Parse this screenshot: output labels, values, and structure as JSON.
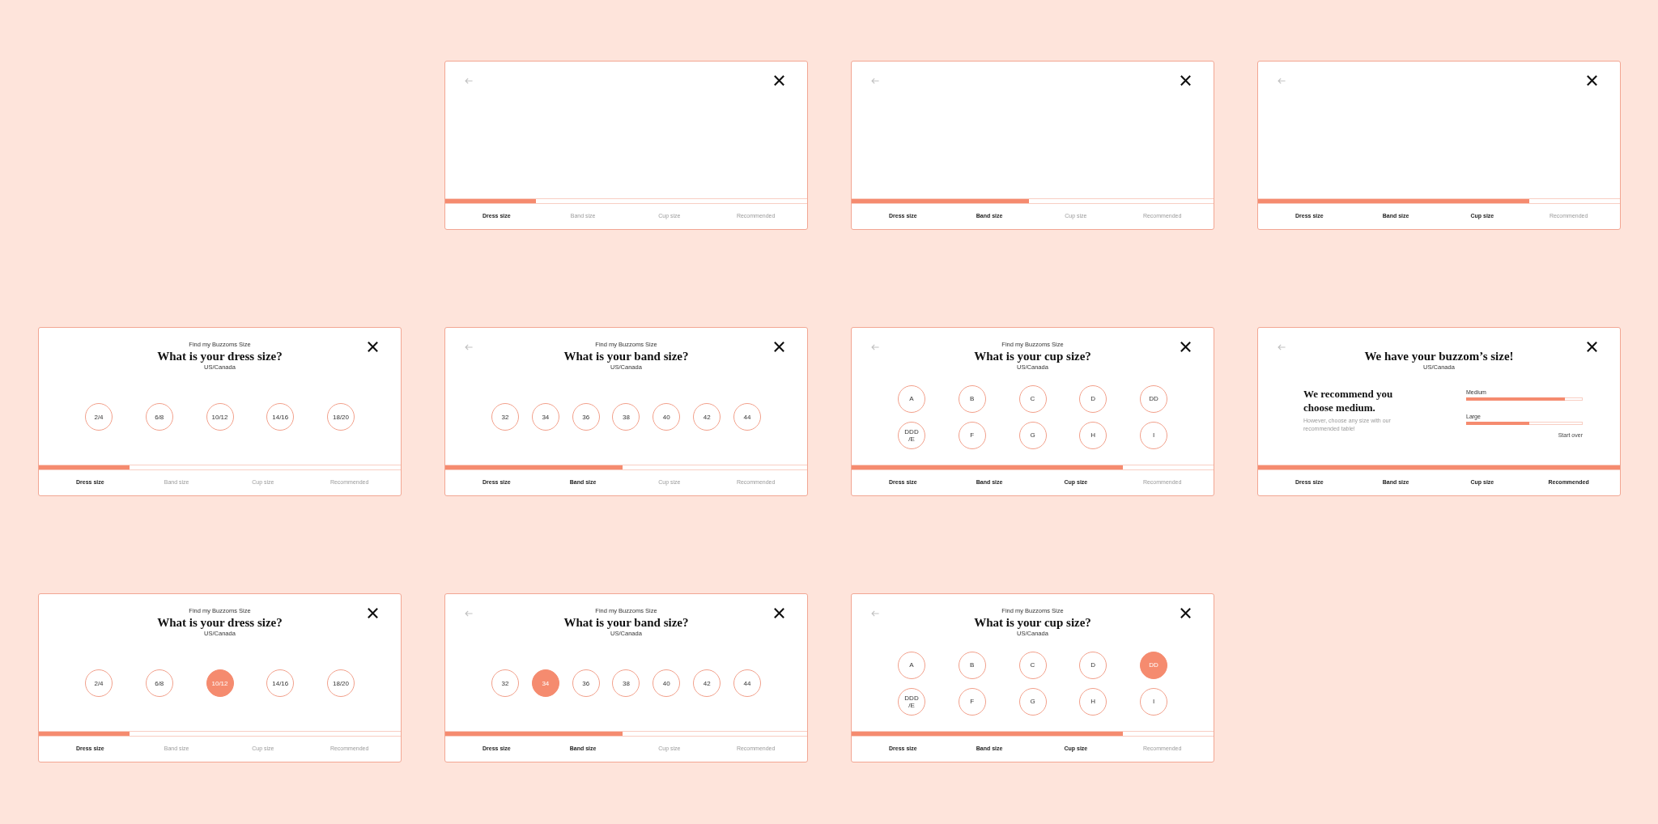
{
  "rows": [
    {
      "cards": [
        {
          "kind": "blank",
          "back_button": true,
          "progress": {
            "level": 0.25
          },
          "steps": [
            {
              "label": "Dress size",
              "active": true
            },
            {
              "label": "Band size",
              "active": false
            },
            {
              "label": "Cup size",
              "active": false
            },
            {
              "label": "Recommended",
              "active": false
            }
          ]
        },
        {
          "kind": "blank",
          "back_button": true,
          "progress": {
            "level": 0.49
          },
          "steps": [
            {
              "label": "Dress size",
              "active": true
            },
            {
              "label": "Band size",
              "active": true
            },
            {
              "label": "Cup size",
              "active": false
            },
            {
              "label": "Recommended",
              "active": false
            }
          ]
        },
        {
          "kind": "blank",
          "back_button": true,
          "progress": {
            "level": 0.75
          },
          "steps": [
            {
              "label": "Dress size",
              "active": true
            },
            {
              "label": "Band size",
              "active": true
            },
            {
              "label": "Cup size",
              "active": true
            },
            {
              "label": "Recommended",
              "active": false
            }
          ]
        }
      ]
    },
    {
      "cards": [
        {
          "kind": "question",
          "back_button": false,
          "eyebrow": "Find my Buzzoms Size",
          "title": "What is your dress size?",
          "region": "US/Canada",
          "option_rows": [
            [
              {
                "label": "2/4",
                "selected": false
              },
              {
                "label": "6/8",
                "selected": false
              },
              {
                "label": "10/12",
                "selected": false
              },
              {
                "label": "14/16",
                "selected": false
              },
              {
                "label": "18/20",
                "selected": false
              }
            ]
          ],
          "progress": {
            "level": 0.25
          },
          "steps": [
            {
              "label": "Dress size",
              "active": true
            },
            {
              "label": "Band size",
              "active": false
            },
            {
              "label": "Cup size",
              "active": false
            },
            {
              "label": "Recommended",
              "active": false
            }
          ]
        },
        {
          "kind": "question",
          "back_button": true,
          "eyebrow": "Find my Buzzoms Size",
          "title": "What is your band size?",
          "region": "US/Canada",
          "option_rows": [
            [
              {
                "label": "32",
                "selected": false
              },
              {
                "label": "34",
                "selected": false
              },
              {
                "label": "36",
                "selected": false
              },
              {
                "label": "38",
                "selected": false
              },
              {
                "label": "40",
                "selected": false
              },
              {
                "label": "42",
                "selected": false
              },
              {
                "label": "44",
                "selected": false
              }
            ]
          ],
          "progress": {
            "level": 0.49
          },
          "steps": [
            {
              "label": "Dress size",
              "active": true
            },
            {
              "label": "Band size",
              "active": true
            },
            {
              "label": "Cup size",
              "active": false
            },
            {
              "label": "Recommended",
              "active": false
            }
          ]
        },
        {
          "kind": "question",
          "back_button": true,
          "eyebrow": "Find my Buzzoms Size",
          "title": "What is your cup size?",
          "region": "US/Canada",
          "option_rows": [
            [
              {
                "label": "A",
                "selected": false
              },
              {
                "label": "B",
                "selected": false
              },
              {
                "label": "C",
                "selected": false
              },
              {
                "label": "D",
                "selected": false
              },
              {
                "label": "DD",
                "selected": false
              }
            ],
            [
              {
                "label": "DDD /E",
                "selected": false
              },
              {
                "label": "F",
                "selected": false
              },
              {
                "label": "G",
                "selected": false
              },
              {
                "label": "H",
                "selected": false
              },
              {
                "label": "I",
                "selected": false
              }
            ]
          ],
          "progress": {
            "level": 0.75
          },
          "steps": [
            {
              "label": "Dress size",
              "active": true
            },
            {
              "label": "Band size",
              "active": true
            },
            {
              "label": "Cup size",
              "active": true
            },
            {
              "label": "Recommended",
              "active": false
            }
          ]
        },
        {
          "kind": "result",
          "back_button": true,
          "title": "We have your buzzom’s size!",
          "region": "US/Canada",
          "recommendation": {
            "heading": "We recommend you choose medium.",
            "note": "However, choose any size with our recommended table!"
          },
          "matches": [
            {
              "label": "Medium",
              "level": 0.85
            },
            {
              "label": "Large",
              "level": 0.54
            }
          ],
          "action": "Start over",
          "progress": {
            "level": 1
          },
          "steps": [
            {
              "label": "Dress size",
              "active": true
            },
            {
              "label": "Band size",
              "active": true
            },
            {
              "label": "Cup size",
              "active": true
            },
            {
              "label": "Recommended",
              "active": true
            }
          ]
        }
      ]
    },
    {
      "cards": [
        {
          "kind": "question",
          "back_button": false,
          "eyebrow": "Find my Buzzoms Size",
          "title": "What is your dress size?",
          "region": "US/Canada",
          "option_rows": [
            [
              {
                "label": "2/4",
                "selected": false
              },
              {
                "label": "6/8",
                "selected": false
              },
              {
                "label": "10/12",
                "selected": true
              },
              {
                "label": "14/16",
                "selected": false
              },
              {
                "label": "18/20",
                "selected": false
              }
            ]
          ],
          "progress": {
            "level": 0.25
          },
          "steps": [
            {
              "label": "Dress size",
              "active": true
            },
            {
              "label": "Band size",
              "active": false
            },
            {
              "label": "Cup size",
              "active": false
            },
            {
              "label": "Recommended",
              "active": false
            }
          ]
        },
        {
          "kind": "question",
          "back_button": true,
          "eyebrow": "Find my Buzzoms Size",
          "title": "What is your band size?",
          "region": "US/Canada",
          "option_rows": [
            [
              {
                "label": "32",
                "selected": false
              },
              {
                "label": "34",
                "selected": true
              },
              {
                "label": "36",
                "selected": false
              },
              {
                "label": "38",
                "selected": false
              },
              {
                "label": "40",
                "selected": false
              },
              {
                "label": "42",
                "selected": false
              },
              {
                "label": "44",
                "selected": false
              }
            ]
          ],
          "progress": {
            "level": 0.49
          },
          "steps": [
            {
              "label": "Dress size",
              "active": true
            },
            {
              "label": "Band size",
              "active": true
            },
            {
              "label": "Cup size",
              "active": false
            },
            {
              "label": "Recommended",
              "active": false
            }
          ]
        },
        {
          "kind": "question",
          "back_button": true,
          "eyebrow": "Find my Buzzoms Size",
          "title": "What is your cup size?",
          "region": "US/Canada",
          "option_rows": [
            [
              {
                "label": "A",
                "selected": false
              },
              {
                "label": "B",
                "selected": false
              },
              {
                "label": "C",
                "selected": false
              },
              {
                "label": "D",
                "selected": false
              },
              {
                "label": "DD",
                "selected": true
              }
            ],
            [
              {
                "label": "DDD /E",
                "selected": false
              },
              {
                "label": "F",
                "selected": false
              },
              {
                "label": "G",
                "selected": false
              },
              {
                "label": "H",
                "selected": false
              },
              {
                "label": "I",
                "selected": false
              }
            ]
          ],
          "progress": {
            "level": 0.75
          },
          "steps": [
            {
              "label": "Dress size",
              "active": true
            },
            {
              "label": "Band size",
              "active": true
            },
            {
              "label": "Cup size",
              "active": true
            },
            {
              "label": "Recommended",
              "active": false
            }
          ]
        }
      ]
    }
  ]
}
